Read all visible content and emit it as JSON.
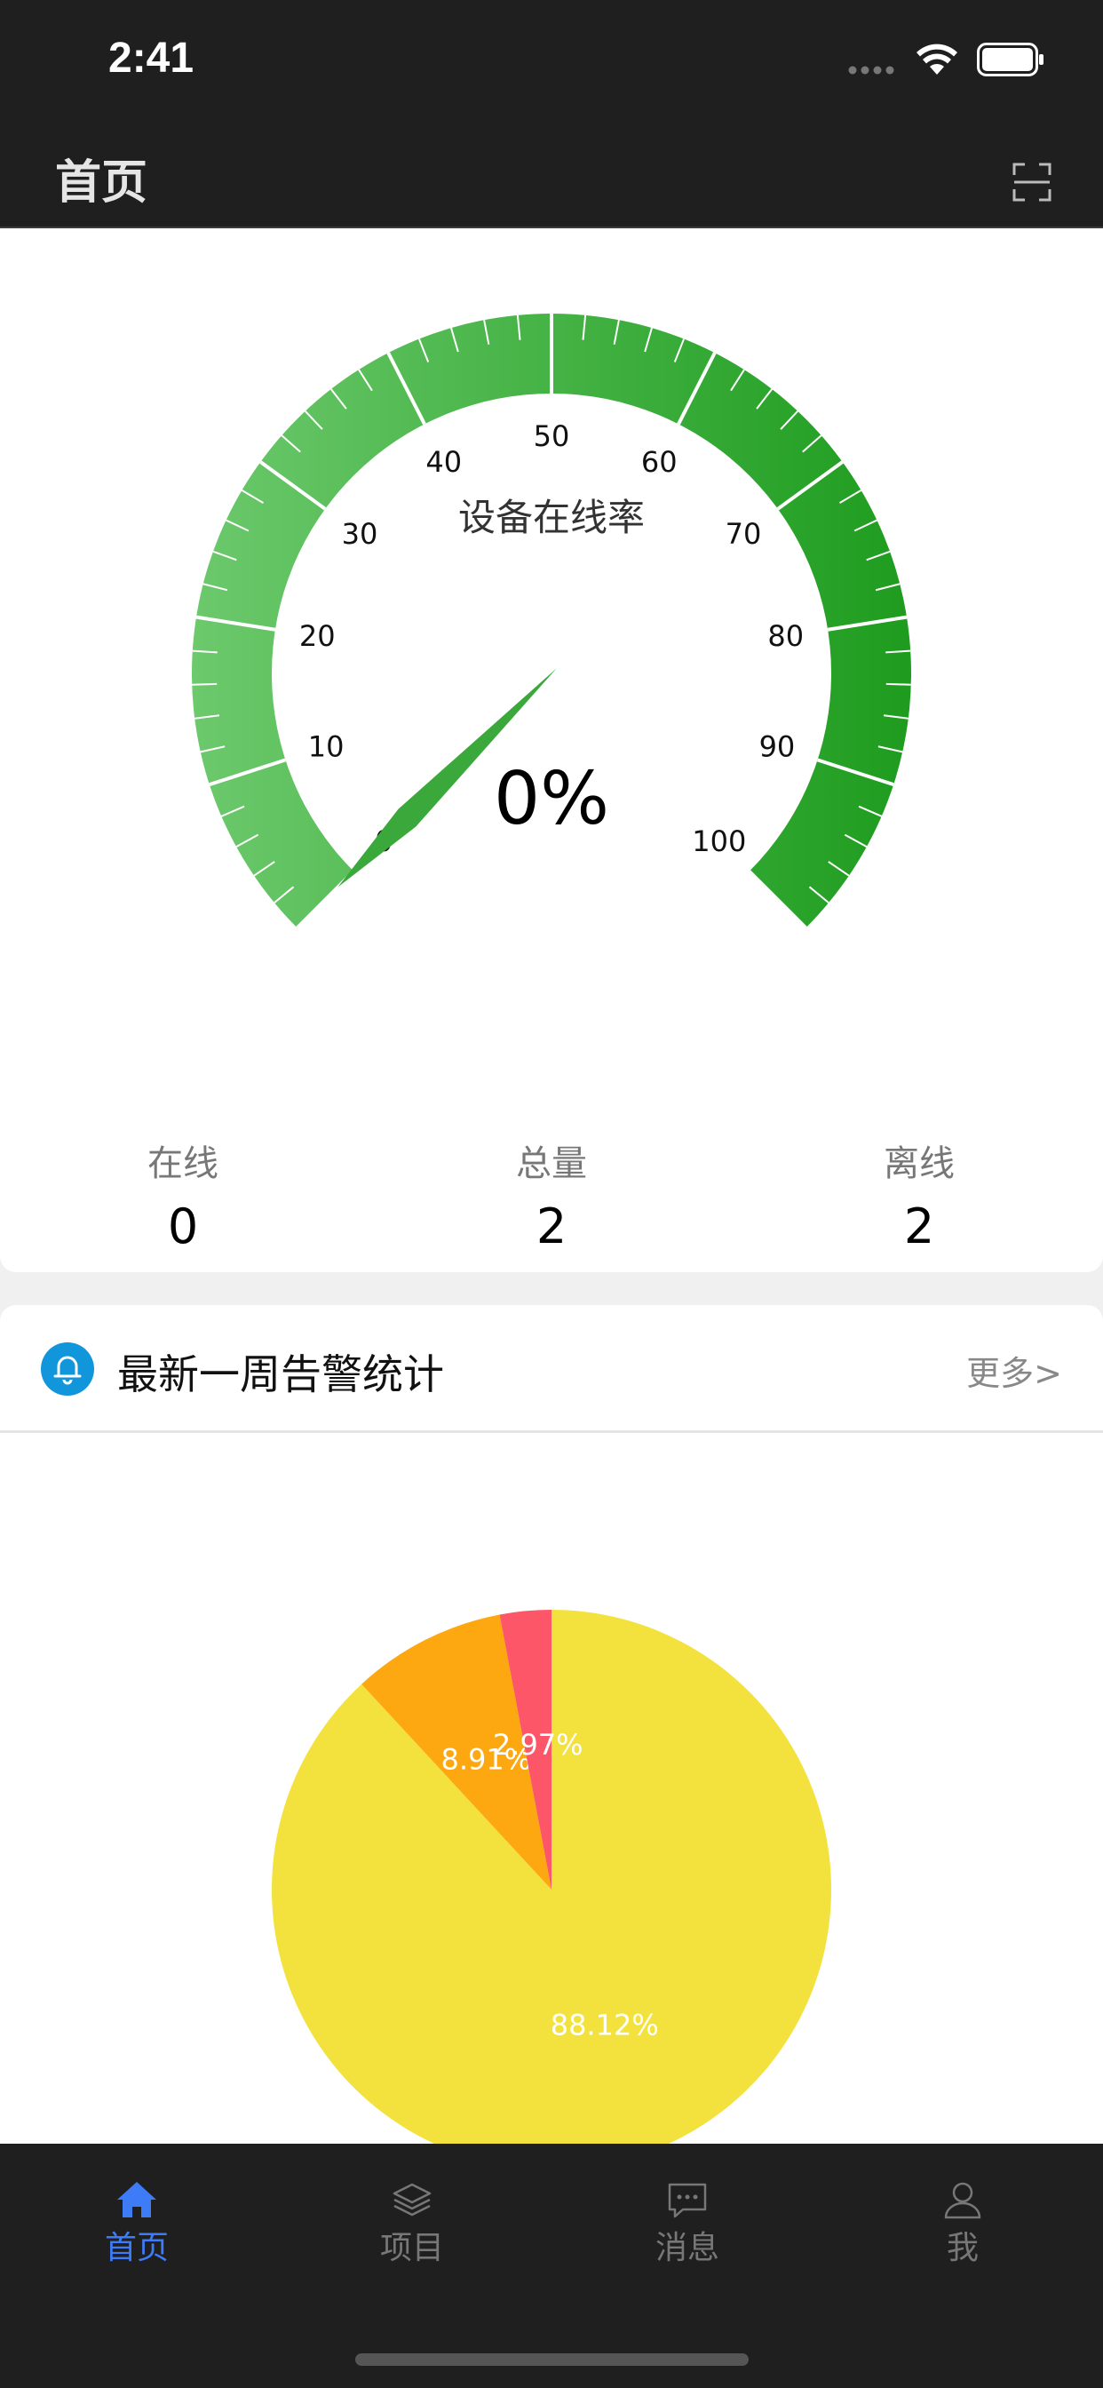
{
  "status_bar": {
    "time": "2:41"
  },
  "nav": {
    "title": "首页",
    "scan_icon": "scan-icon"
  },
  "gauge": {
    "title": "设备在线率",
    "value_text": "0%",
    "value": 0,
    "min": 0,
    "max": 100,
    "tick_labels": [
      "0",
      "10",
      "20",
      "30",
      "40",
      "50",
      "60",
      "70",
      "80",
      "90",
      "100"
    ],
    "colors": {
      "start": "#6cc96c",
      "end": "#1e9c1e"
    }
  },
  "stats": [
    {
      "label": "在线",
      "value": "0"
    },
    {
      "label": "总量",
      "value": "2"
    },
    {
      "label": "离线",
      "value": "2"
    }
  ],
  "alarm": {
    "title": "最新一周告警统计",
    "more": "更多>",
    "icon": "bell-icon"
  },
  "chart_data": {
    "type": "pie",
    "slices": [
      {
        "label": "88.12%",
        "value": 88.12,
        "color": "#f3e23e"
      },
      {
        "label": "8.91%",
        "value": 8.91,
        "color": "#fda810"
      },
      {
        "label": "2.97%",
        "value": 2.97,
        "color": "#fc5668"
      }
    ]
  },
  "tabs": [
    {
      "label": "首页",
      "icon": "home-icon",
      "active": true
    },
    {
      "label": "项目",
      "icon": "layers-icon",
      "active": false
    },
    {
      "label": "消息",
      "icon": "message-icon",
      "active": false
    },
    {
      "label": "我",
      "icon": "user-icon",
      "active": false
    }
  ],
  "accent": "#3d7bf7"
}
